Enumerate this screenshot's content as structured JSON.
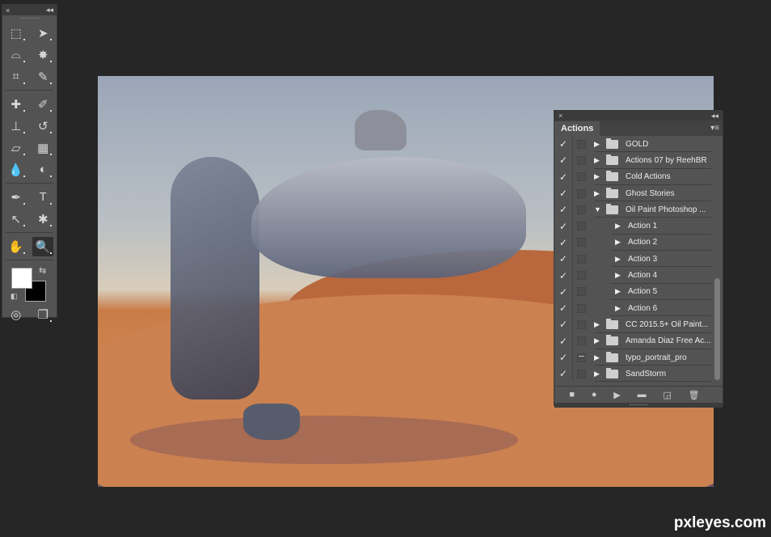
{
  "tools_panel": {
    "close_icon": "×",
    "collapse_icon": "◂◂",
    "tools": [
      [
        "rectangular-marquee-tool",
        "move-tool"
      ],
      [
        "polygonal-lasso-tool",
        "magic-wand-tool"
      ],
      [
        "crop-tool",
        "eyedropper-tool"
      ],
      [
        "spot-healing-brush-tool",
        "brush-tool"
      ],
      [
        "clone-stamp-tool",
        "history-brush-tool"
      ],
      [
        "eraser-tool",
        "gradient-tool"
      ],
      [
        "blur-tool",
        "dodge-tool"
      ],
      [
        "pen-tool",
        "type-tool"
      ],
      [
        "path-selection-tool",
        "custom-shape-tool"
      ],
      [
        "hand-tool",
        "zoom-tool"
      ]
    ],
    "glyphs": {
      "rectangular-marquee-tool": "⬚",
      "move-tool": "➤",
      "polygonal-lasso-tool": "⌓",
      "magic-wand-tool": "✸",
      "crop-tool": "⌗",
      "eyedropper-tool": "✎",
      "spot-healing-brush-tool": "✚",
      "brush-tool": "✐",
      "clone-stamp-tool": "⊥",
      "history-brush-tool": "↺",
      "eraser-tool": "▱",
      "gradient-tool": "▦",
      "blur-tool": "💧",
      "dodge-tool": "◐",
      "pen-tool": "✒",
      "type-tool": "T",
      "path-selection-tool": "↖",
      "custom-shape-tool": "✱",
      "hand-tool": "✋",
      "zoom-tool": "🔍",
      "quick-mask": "◎",
      "screen-mode": "❐",
      "swap-colors": "⇆",
      "default-colors": "◧"
    },
    "active_tool": "zoom-tool",
    "foreground_color": "#ffffff",
    "background_color": "#000000"
  },
  "actions_panel": {
    "tab_label": "Actions",
    "close_icon": "×",
    "collapse_icon": "◂◂",
    "menu_icon": "▾≡",
    "rows": [
      {
        "label": "GOLD",
        "type": "set",
        "expanded": false,
        "checked": true,
        "dialog": false
      },
      {
        "label": "Actions 07 by ReehBR",
        "type": "set",
        "expanded": false,
        "checked": true,
        "dialog": false
      },
      {
        "label": "Cold Actions",
        "type": "set",
        "expanded": false,
        "checked": true,
        "dialog": false
      },
      {
        "label": "Ghost Stories",
        "type": "set",
        "expanded": false,
        "checked": true,
        "dialog": false
      },
      {
        "label": "Oil Paint Photoshop ...",
        "type": "set",
        "expanded": true,
        "checked": true,
        "dialog": false
      },
      {
        "label": "Action 1",
        "type": "action",
        "expanded": false,
        "checked": true,
        "dialog": false
      },
      {
        "label": "Action 2",
        "type": "action",
        "expanded": false,
        "checked": true,
        "dialog": false
      },
      {
        "label": "Action 3",
        "type": "action",
        "expanded": false,
        "checked": true,
        "dialog": false
      },
      {
        "label": "Action 4",
        "type": "action",
        "expanded": false,
        "checked": true,
        "dialog": false
      },
      {
        "label": "Action 5",
        "type": "action",
        "expanded": false,
        "checked": true,
        "dialog": false
      },
      {
        "label": "Action 6",
        "type": "action",
        "expanded": false,
        "checked": true,
        "dialog": false
      },
      {
        "label": "CC 2015.5+ Oil Paint...",
        "type": "set",
        "expanded": false,
        "checked": true,
        "dialog": false
      },
      {
        "label": "Amanda Diaz Free Ac...",
        "type": "set",
        "expanded": false,
        "checked": true,
        "dialog": false
      },
      {
        "label": "typo_portrait_pro",
        "type": "set",
        "expanded": false,
        "checked": true,
        "dialog": true
      },
      {
        "label": "SandStorm",
        "type": "set",
        "expanded": false,
        "checked": true,
        "dialog": false
      }
    ],
    "bottom_buttons": [
      {
        "name": "stop-button",
        "glyph": "■"
      },
      {
        "name": "record-button",
        "glyph": "●"
      },
      {
        "name": "play-button",
        "glyph": "▶"
      },
      {
        "name": "new-set-button",
        "glyph": "▬"
      },
      {
        "name": "new-action-button",
        "glyph": "◲"
      },
      {
        "name": "delete-button",
        "glyph": "🗑"
      }
    ]
  },
  "watermark": "pxleyes.com"
}
